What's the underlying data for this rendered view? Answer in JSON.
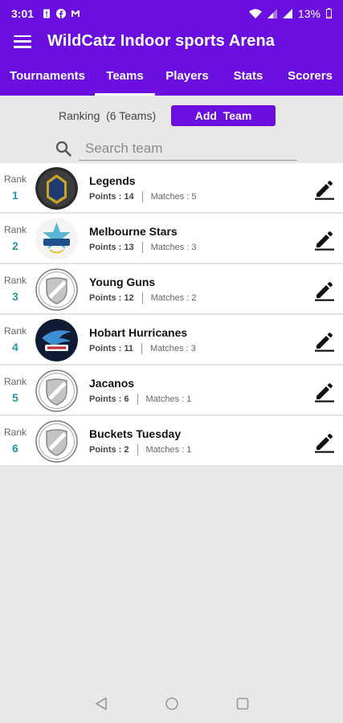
{
  "status_bar": {
    "time": "3:01",
    "battery": "13%",
    "icons": [
      "sim-alert-icon",
      "facebook-icon",
      "gmail-icon",
      "wifi-icon",
      "signal-icon",
      "signal-icon",
      "battery-icon"
    ]
  },
  "app_bar": {
    "title": "WildCatz Indoor sports Arena"
  },
  "tabs": [
    {
      "label": "Tournaments",
      "active": false
    },
    {
      "label": "Teams",
      "active": true
    },
    {
      "label": "Players",
      "active": false
    },
    {
      "label": "Stats",
      "active": false
    },
    {
      "label": "Scorers",
      "active": false
    }
  ],
  "toolbar": {
    "ranking_text": "Ranking  (6 Teams)",
    "add_team_label": "Add  Team"
  },
  "search": {
    "placeholder": "Search team",
    "value": ""
  },
  "rank_label": "Rank",
  "teams": [
    {
      "rank": "1",
      "name": "Legends",
      "points_label": "Points : 14",
      "matches_label": "Matches : 5",
      "logo": "51-tons-logo"
    },
    {
      "rank": "2",
      "name": "Melbourne Stars",
      "points_label": "Points : 13",
      "matches_label": "Matches : 3",
      "logo": "stars-logo"
    },
    {
      "rank": "3",
      "name": "Young Guns",
      "points_label": "Points : 12",
      "matches_label": "Matches : 2",
      "logo": "default-shield-logo"
    },
    {
      "rank": "4",
      "name": "Hobart Hurricanes",
      "points_label": "Points : 11",
      "matches_label": "Matches : 3",
      "logo": "eagles-logo"
    },
    {
      "rank": "5",
      "name": "Jacanos",
      "points_label": "Points : 6",
      "matches_label": "Matches : 1",
      "logo": "default-shield-logo"
    },
    {
      "rank": "6",
      "name": "Buckets Tuesday",
      "points_label": "Points : 2",
      "matches_label": "Matches : 1",
      "logo": "default-shield-logo"
    }
  ],
  "colors": {
    "primary": "#6a0fe0",
    "rank_number": "#2196a8",
    "background": "#e8e8e8"
  }
}
